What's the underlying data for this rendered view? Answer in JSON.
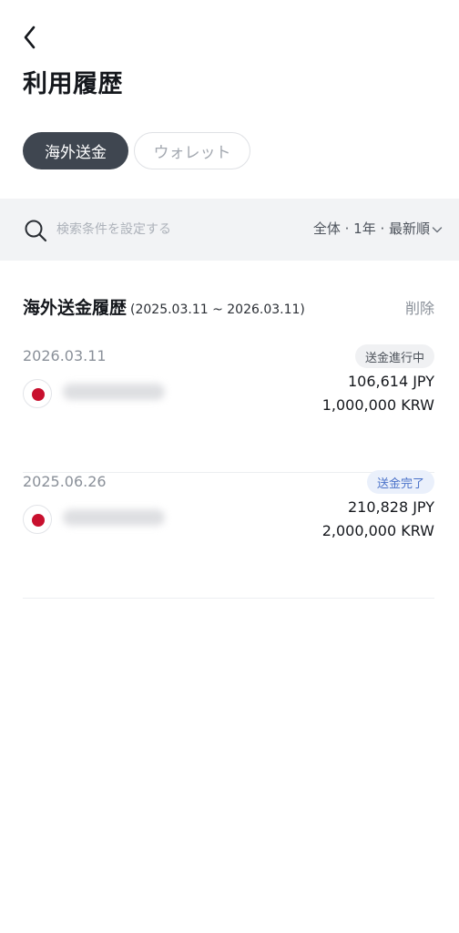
{
  "header": {
    "title": "利用履歴"
  },
  "tabs": [
    {
      "label": "海外送金",
      "active": true
    },
    {
      "label": "ウォレット",
      "active": false
    }
  ],
  "search": {
    "placeholder": "検索条件を設定する",
    "filter_label": "全体 · 1年 · 最新順"
  },
  "section": {
    "title": "海外送金履歴",
    "range": "(2025.03.11 ~ 2026.03.11)",
    "delete_label": "削除"
  },
  "transactions": [
    {
      "date": "2026.03.11",
      "status": "送金進行中",
      "flag_icon": "japan-flag-icon",
      "amount_jpy": "106,614 JPY",
      "amount_krw": "1,000,000 KRW"
    },
    {
      "date": "2025.06.26",
      "status": "送金完了",
      "flag_icon": "japan-flag-icon",
      "amount_jpy": "210,828 JPY",
      "amount_krw": "2,000,000 KRW"
    }
  ],
  "colors": {
    "active_tab": "#3f4650",
    "search_bg": "#f2f3f5",
    "badge_done_text": "#4a72c9",
    "japan_red": "#c8102e"
  }
}
